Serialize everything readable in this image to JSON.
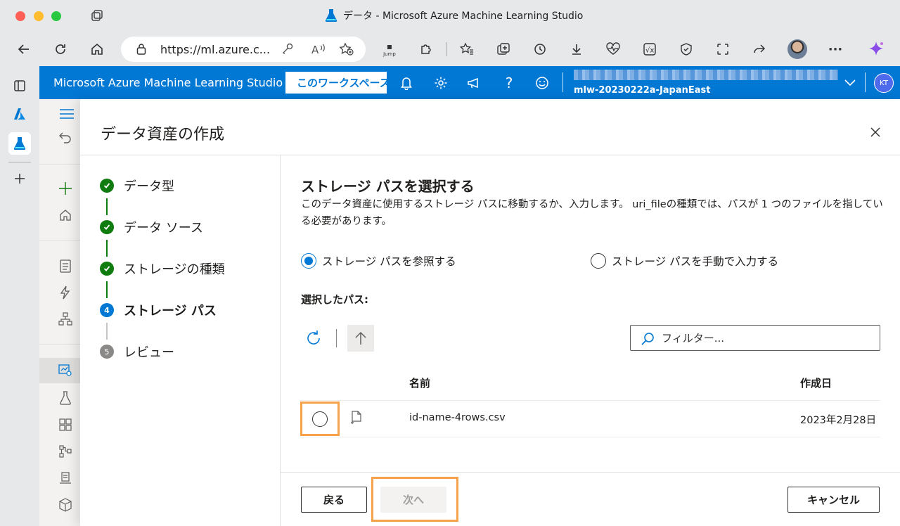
{
  "browser": {
    "tab_title": "データ - Microsoft Azure Machine Learning Studio",
    "url": "https://ml.azure.c...",
    "jump_label": "Jump"
  },
  "header": {
    "app_title": "Microsoft Azure Machine Learning Studio",
    "workspace_button": "このワークスペース",
    "workspace_name": "mlw-20230222a-JapanEast",
    "avatar_initials": "KT"
  },
  "panel": {
    "title": "データ資産の作成",
    "steps": [
      {
        "number": "1",
        "label": "データ型",
        "state": "done"
      },
      {
        "number": "2",
        "label": "データ ソース",
        "state": "done"
      },
      {
        "number": "3",
        "label": "ストレージの種類",
        "state": "done"
      },
      {
        "number": "4",
        "label": "ストレージ パス",
        "state": "current"
      },
      {
        "number": "5",
        "label": "レビュー",
        "state": "todo"
      }
    ],
    "heading": "ストレージ パスを選択する",
    "description": "このデータ資産に使用するストレージ パスに移動するか、入力します。 uri_fileの種類では、パスが 1 つのファイルを指している必要があります。",
    "radio_browse": "ストレージ パスを参照する",
    "radio_manual": "ストレージ パスを手動で入力する",
    "selected_path_label": "選択したパス:",
    "filter_placeholder": "フィルター...",
    "table": {
      "headers": [
        "名前",
        "作成日"
      ],
      "rows": [
        {
          "name": "id-name-4rows.csv",
          "created": "2023年2月28日"
        }
      ]
    },
    "buttons": {
      "back": "戻る",
      "next": "次へ",
      "cancel": "キャンセル"
    }
  },
  "colors": {
    "azure_blue": "#0078d4",
    "done_green": "#107c10",
    "highlight_orange": "#f7a14b"
  }
}
